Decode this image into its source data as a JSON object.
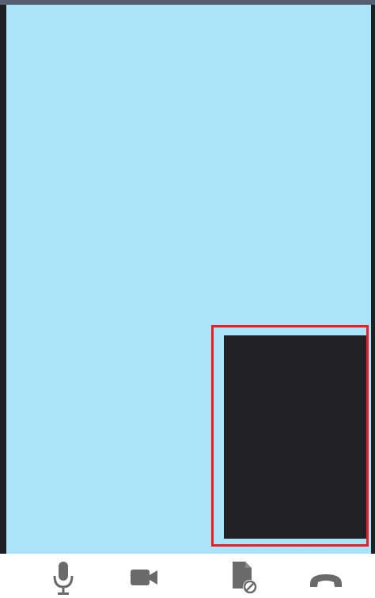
{
  "call": {
    "remote_video": {
      "background": "#abe3f9"
    },
    "local_preview": {
      "background": "#222126"
    },
    "highlight": {
      "color": "#ee1c24"
    }
  },
  "controls": [
    {
      "name": "microphone",
      "icon": "microphone-icon"
    },
    {
      "name": "camera",
      "icon": "video-camera-icon"
    },
    {
      "name": "screen-share-off",
      "icon": "document-blocked-icon"
    },
    {
      "name": "end-call",
      "icon": "phone-hangup-icon"
    }
  ],
  "colors": {
    "icon": "#6a6a6a",
    "control_bar": "#ffffff",
    "status_strip": "#566070"
  }
}
